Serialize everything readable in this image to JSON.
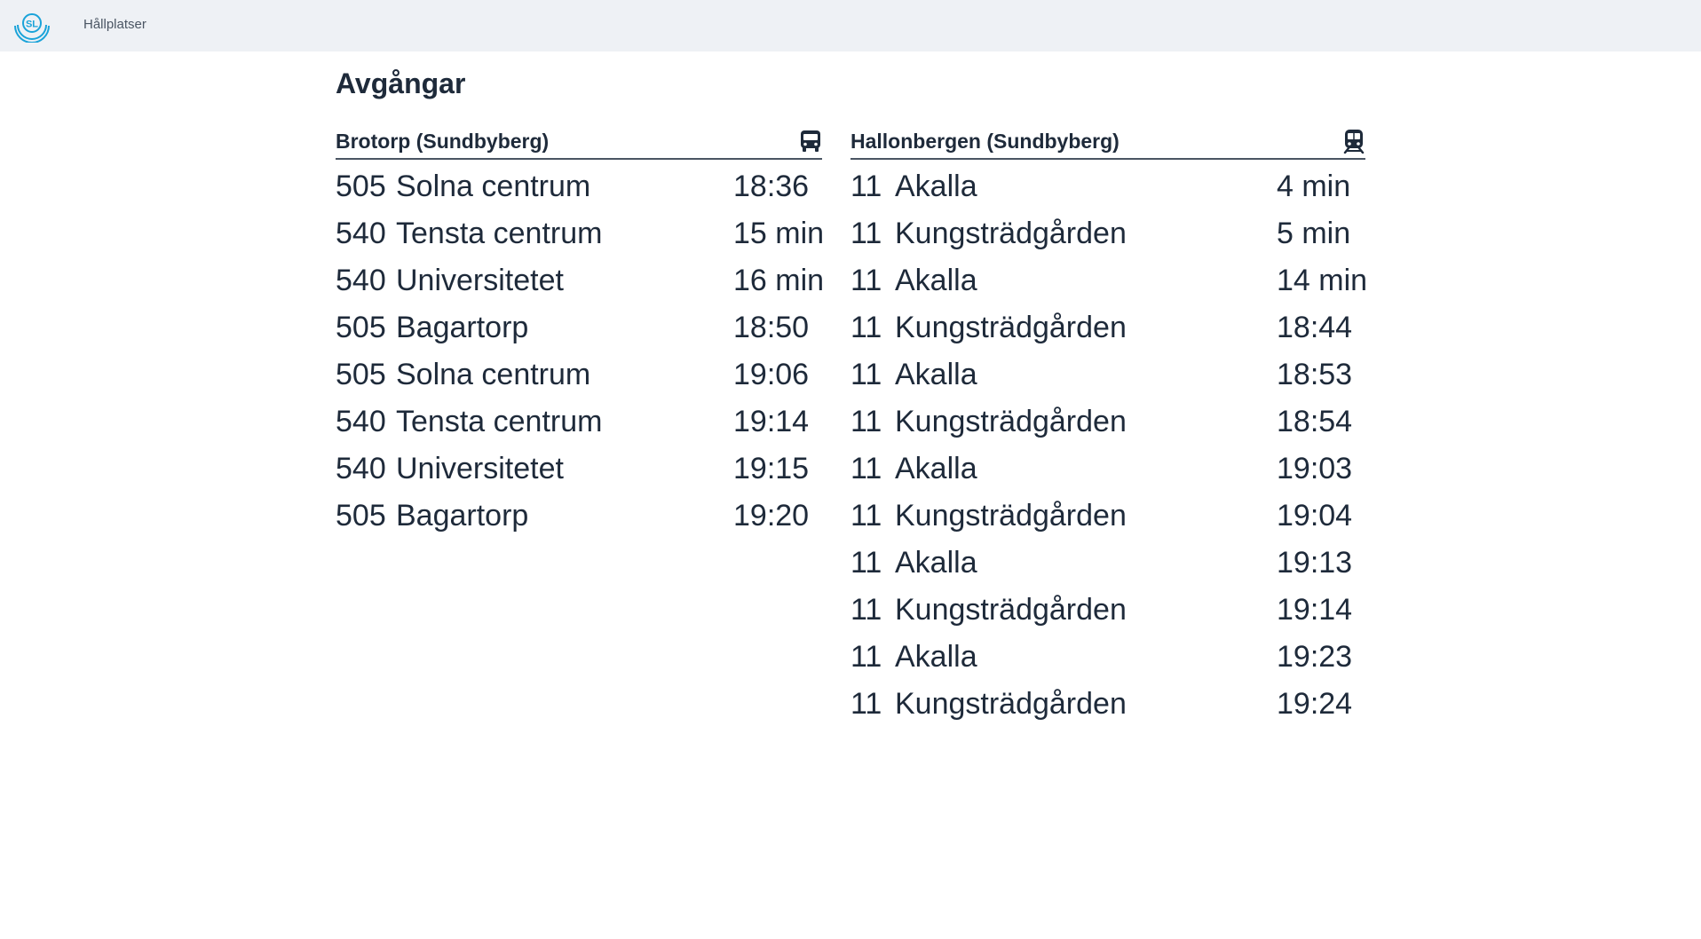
{
  "nav": {
    "logo_text": "SL",
    "link_label": "Hållplatser"
  },
  "page_title": "Avgångar",
  "colors": {
    "topbar_bg": "#eef1f5",
    "logo": "#1aa3d9",
    "text": "#1e2a3a",
    "divider": "#4a5563"
  },
  "boards": [
    {
      "stop": "Brotorp (Sundbyberg)",
      "mode_icon": "bus-icon",
      "departures": [
        {
          "line": "505",
          "destination": "Solna centrum",
          "time": "18:36"
        },
        {
          "line": "540",
          "destination": "Tensta centrum",
          "time": "15 min"
        },
        {
          "line": "540",
          "destination": "Universitetet",
          "time": "16 min"
        },
        {
          "line": "505",
          "destination": "Bagartorp",
          "time": "18:50"
        },
        {
          "line": "505",
          "destination": "Solna centrum",
          "time": "19:06"
        },
        {
          "line": "540",
          "destination": "Tensta centrum",
          "time": "19:14"
        },
        {
          "line": "540",
          "destination": "Universitetet",
          "time": "19:15"
        },
        {
          "line": "505",
          "destination": "Bagartorp",
          "time": "19:20"
        }
      ]
    },
    {
      "stop": "Hallonbergen (Sundbyberg)",
      "mode_icon": "metro-icon",
      "departures": [
        {
          "line": "11",
          "destination": "Akalla",
          "time": "4 min"
        },
        {
          "line": "11",
          "destination": "Kungsträdgården",
          "time": "5 min"
        },
        {
          "line": "11",
          "destination": "Akalla",
          "time": "14 min"
        },
        {
          "line": "11",
          "destination": "Kungsträdgården",
          "time": "18:44"
        },
        {
          "line": "11",
          "destination": "Akalla",
          "time": "18:53"
        },
        {
          "line": "11",
          "destination": "Kungsträdgården",
          "time": "18:54"
        },
        {
          "line": "11",
          "destination": "Akalla",
          "time": "19:03"
        },
        {
          "line": "11",
          "destination": "Kungsträdgården",
          "time": "19:04"
        },
        {
          "line": "11",
          "destination": "Akalla",
          "time": "19:13"
        },
        {
          "line": "11",
          "destination": "Kungsträdgården",
          "time": "19:14"
        },
        {
          "line": "11",
          "destination": "Akalla",
          "time": "19:23"
        },
        {
          "line": "11",
          "destination": "Kungsträdgården",
          "time": "19:24"
        }
      ]
    }
  ]
}
